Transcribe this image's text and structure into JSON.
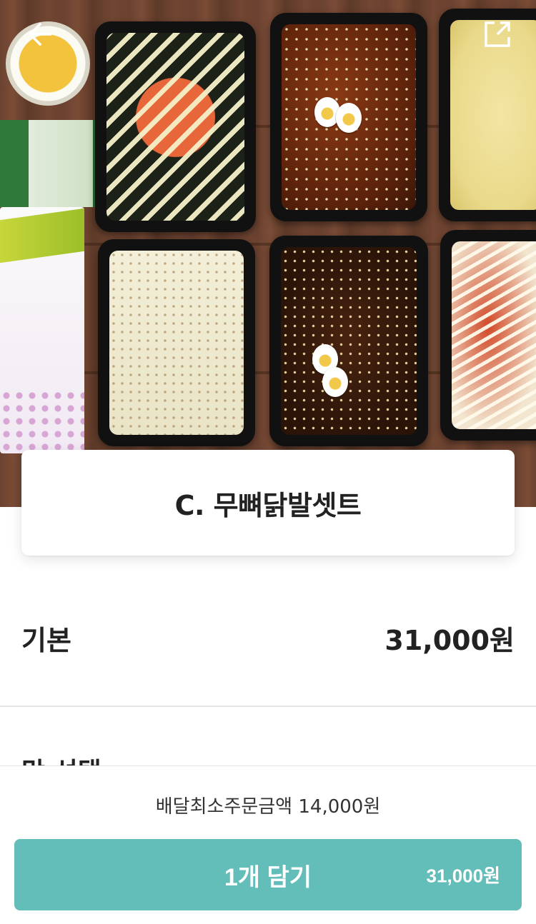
{
  "header": {
    "back_icon": "arrow-left-icon",
    "share_icon": "external-link-icon"
  },
  "product": {
    "title": "C. 무뼈닭발셋트",
    "image_desc_icon": "food-photo"
  },
  "options": {
    "base_label": "기본",
    "base_price": "31,000원",
    "next_section_label": "맛 선택"
  },
  "footer": {
    "min_order_text": "배달최소주문금액 14,000원",
    "add_button_label": "1개 담기",
    "add_button_price": "31,000원"
  },
  "colors": {
    "accent": "#63bdb8",
    "text": "#222222"
  }
}
